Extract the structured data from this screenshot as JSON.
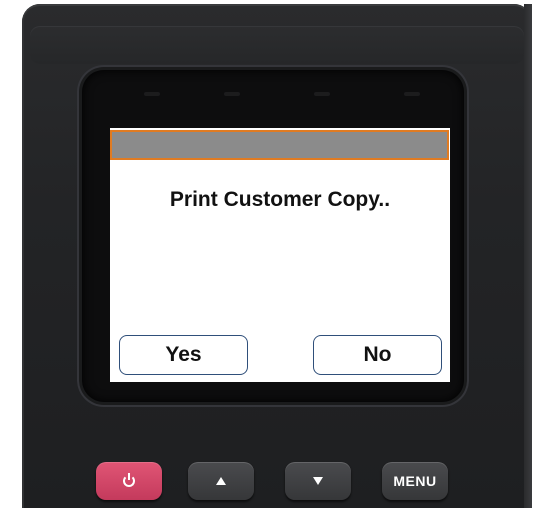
{
  "dialog": {
    "message": "Print Customer Copy..",
    "yes_label": "Yes",
    "no_label": "No"
  },
  "keypad": {
    "menu_label": "MENU",
    "power_icon": "power-icon",
    "up_icon": "arrow-up-icon",
    "down_icon": "arrow-down-icon"
  },
  "colors": {
    "titlebar_fill": "#8b8b8b",
    "titlebar_border": "#e07b22",
    "button_border": "#2f4f7a",
    "power_button": "#d34868"
  }
}
